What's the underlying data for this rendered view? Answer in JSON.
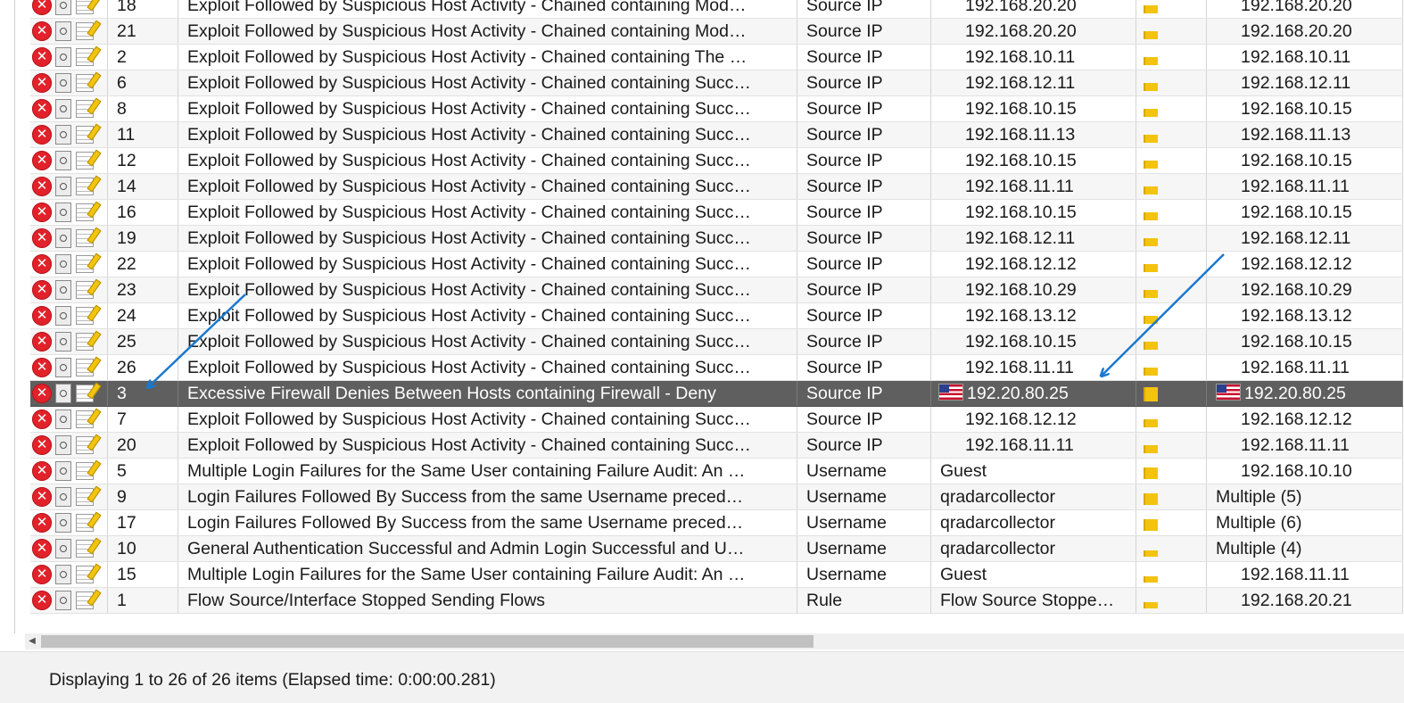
{
  "offenses": [
    {
      "id": "18",
      "description": "Exploit Followed by Suspicious Host Activity - Chained containing Mod…",
      "offense_type": "Source IP",
      "offense_source": "192.168.20.20",
      "magnitude": 0.5,
      "source_ip": "192.168.20.20"
    },
    {
      "id": "21",
      "description": "Exploit Followed by Suspicious Host Activity - Chained containing Mod…",
      "offense_type": "Source IP",
      "offense_source": "192.168.20.20",
      "magnitude": 0.5,
      "source_ip": "192.168.20.20"
    },
    {
      "id": "2",
      "description": "Exploit Followed by Suspicious Host Activity - Chained containing The …",
      "offense_type": "Source IP",
      "offense_source": "192.168.10.11",
      "magnitude": 0.5,
      "source_ip": "192.168.10.11"
    },
    {
      "id": "6",
      "description": "Exploit Followed by Suspicious Host Activity - Chained containing Succ…",
      "offense_type": "Source IP",
      "offense_source": "192.168.12.11",
      "magnitude": 0.5,
      "source_ip": "192.168.12.11"
    },
    {
      "id": "8",
      "description": "Exploit Followed by Suspicious Host Activity - Chained containing Succ…",
      "offense_type": "Source IP",
      "offense_source": "192.168.10.15",
      "magnitude": 0.5,
      "source_ip": "192.168.10.15"
    },
    {
      "id": "11",
      "description": "Exploit Followed by Suspicious Host Activity - Chained containing Succ…",
      "offense_type": "Source IP",
      "offense_source": "192.168.11.13",
      "magnitude": 0.5,
      "source_ip": "192.168.11.13"
    },
    {
      "id": "12",
      "description": "Exploit Followed by Suspicious Host Activity - Chained containing Succ…",
      "offense_type": "Source IP",
      "offense_source": "192.168.10.15",
      "magnitude": 0.5,
      "source_ip": "192.168.10.15"
    },
    {
      "id": "14",
      "description": "Exploit Followed by Suspicious Host Activity - Chained containing Succ…",
      "offense_type": "Source IP",
      "offense_source": "192.168.11.11",
      "magnitude": 0.5,
      "source_ip": "192.168.11.11"
    },
    {
      "id": "16",
      "description": "Exploit Followed by Suspicious Host Activity - Chained containing Succ…",
      "offense_type": "Source IP",
      "offense_source": "192.168.10.15",
      "magnitude": 0.5,
      "source_ip": "192.168.10.15"
    },
    {
      "id": "19",
      "description": "Exploit Followed by Suspicious Host Activity - Chained containing Succ…",
      "offense_type": "Source IP",
      "offense_source": "192.168.12.11",
      "magnitude": 0.5,
      "source_ip": "192.168.12.11"
    },
    {
      "id": "22",
      "description": "Exploit Followed by Suspicious Host Activity - Chained containing Succ…",
      "offense_type": "Source IP",
      "offense_source": "192.168.12.12",
      "magnitude": 0.5,
      "source_ip": "192.168.12.12"
    },
    {
      "id": "23",
      "description": "Exploit Followed by Suspicious Host Activity - Chained containing Succ…",
      "offense_type": "Source IP",
      "offense_source": "192.168.10.29",
      "magnitude": 0.5,
      "source_ip": "192.168.10.29"
    },
    {
      "id": "24",
      "description": "Exploit Followed by Suspicious Host Activity - Chained containing Succ…",
      "offense_type": "Source IP",
      "offense_source": "192.168.13.12",
      "magnitude": 0.5,
      "source_ip": "192.168.13.12"
    },
    {
      "id": "25",
      "description": "Exploit Followed by Suspicious Host Activity - Chained containing Succ…",
      "offense_type": "Source IP",
      "offense_source": "192.168.10.15",
      "magnitude": 0.5,
      "source_ip": "192.168.10.15"
    },
    {
      "id": "26",
      "description": "Exploit Followed by Suspicious Host Activity - Chained containing Succ…",
      "offense_type": "Source IP",
      "offense_source": "192.168.11.11",
      "magnitude": 0.5,
      "source_ip": "192.168.11.11"
    },
    {
      "id": "3",
      "description": "Excessive Firewall Denies Between Hosts containing Firewall - Deny",
      "offense_type": "Source IP",
      "offense_source": "192.20.80.25",
      "magnitude": 0.9,
      "source_ip": "192.20.80.25",
      "selected": true,
      "flag": "us-flag"
    },
    {
      "id": "7",
      "description": "Exploit Followed by Suspicious Host Activity - Chained containing Succ…",
      "offense_type": "Source IP",
      "offense_source": "192.168.12.12",
      "magnitude": 0.5,
      "source_ip": "192.168.12.12"
    },
    {
      "id": "20",
      "description": "Exploit Followed by Suspicious Host Activity - Chained containing Succ…",
      "offense_type": "Source IP",
      "offense_source": "192.168.11.11",
      "magnitude": 0.5,
      "source_ip": "192.168.11.11"
    },
    {
      "id": "5",
      "description": "Multiple Login Failures for the Same User containing Failure Audit: An …",
      "offense_type": "Username",
      "offense_source": "Guest",
      "magnitude": 0.7,
      "source_ip": "192.168.10.10"
    },
    {
      "id": "9",
      "description": "Login Failures Followed By Success from the same Username preced…",
      "offense_type": "Username",
      "offense_source": "qradarcollector",
      "magnitude": 0.7,
      "source_ip": "Multiple (5)"
    },
    {
      "id": "17",
      "description": "Login Failures Followed By Success from the same Username preced…",
      "offense_type": "Username",
      "offense_source": "qradarcollector",
      "magnitude": 0.7,
      "source_ip": "Multiple (6)"
    },
    {
      "id": "10",
      "description": "General Authentication Successful and Admin Login Successful and U…",
      "offense_type": "Username",
      "offense_source": "qradarcollector",
      "magnitude": 0.4,
      "source_ip": "Multiple (4)"
    },
    {
      "id": "15",
      "description": "Multiple Login Failures for the Same User containing Failure Audit: An …",
      "offense_type": "Username",
      "offense_source": "Guest",
      "magnitude": 0.4,
      "source_ip": "192.168.11.11"
    },
    {
      "id": "1",
      "description": "Flow Source/Interface Stopped Sending Flows",
      "offense_type": "Rule",
      "offense_source": "Flow Source Stoppe…",
      "magnitude": 0.4,
      "source_ip": "192.168.20.21"
    }
  ],
  "icons": {
    "close": "close-offense-icon",
    "details": "offense-details-icon",
    "notes": "add-note-icon",
    "scroll_left": "scroll-left-arrow-icon"
  },
  "colors": {
    "selected_row": "#5f5f5f",
    "magnitude_bar": "#f2c40f",
    "close_icon": "#e1222a",
    "annotation_arrow": "#1a78d0"
  },
  "footer": {
    "status": "Displaying 1 to 26 of 26 items (Elapsed time: 0:00:00.281)"
  }
}
